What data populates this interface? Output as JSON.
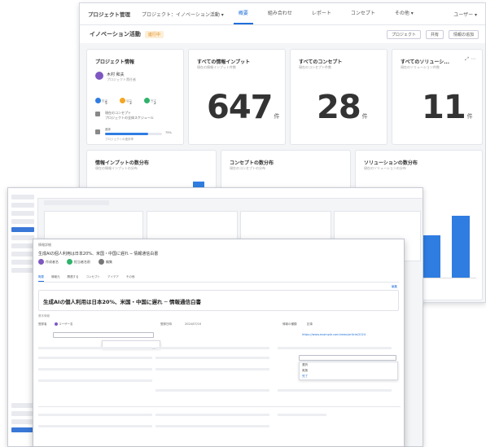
{
  "back_window": {
    "app_title": "プロジェクト管理",
    "breadcrumb": "プロジェクト：イノベーション活動 ▾",
    "nav": [
      "概要",
      "組み合わせ",
      "レポート",
      "コンセプト",
      "その他 ▾"
    ],
    "user_menu": "ユーザー ▾",
    "page_title": "イノベーション活動",
    "status_badge": "進行中",
    "toolbar_buttons": [
      "プロジェクト",
      "共有",
      "情報の追加"
    ],
    "project_info": {
      "title": "プロジェクト情報",
      "owner_name": "木村 和夫",
      "owner_role": "プロジェクト責任者",
      "member_counts": [
        "5",
        "3",
        "2"
      ],
      "member_labels": [
        "担当",
        "協力",
        "完了"
      ],
      "note_line1": "現在のコンセプト",
      "note_line2": "プロジェクトの全体スケジュール",
      "progress_label": "進捗",
      "progress_pct": "75%",
      "progress_value": 0.75,
      "progress_caption": "プロジェクトの進捗率"
    },
    "kpis": [
      {
        "title": "すべての情報インプット",
        "subtitle": "現在の情報インプット件数",
        "value": "647",
        "unit": "件"
      },
      {
        "title": "すべてのコンセプト",
        "subtitle": "現在のコンセプト件数",
        "value": "28",
        "unit": "件"
      },
      {
        "title": "すべてのソリューシ...",
        "subtitle": "現在のソリューション件数",
        "value": "11",
        "unit": "件"
      }
    ],
    "charts": [
      {
        "title": "情報インプットの数分布",
        "subtitle": "現在の情報インプットの分布"
      },
      {
        "title": "コンセプトの数分布",
        "subtitle": "現在のコンセプトの分布"
      },
      {
        "title": "ソリューションの数分布",
        "subtitle": "現在のソリューションの分布"
      }
    ]
  },
  "front_window": {
    "header": "情報詳細",
    "title": "生成AIの個人利用は日本20%、米国・中国に遅れ ─ 情報通信白書",
    "users": [
      "作成者名",
      "担当者名前",
      "編集"
    ],
    "tabs": [
      "概要",
      "情報元",
      "関連する",
      "コンセプト",
      "アイデア",
      "その他"
    ],
    "edit_label": "編集",
    "headline": "生成AIの個人利用は日本20%、米国・中国に遅れ ─ 情報通信白書",
    "section_label": "基本情報",
    "fields": [
      {
        "label": "登録者",
        "value": "ユーザー名"
      },
      {
        "label": "登録日時",
        "value": "2024/07/10"
      },
      {
        "label": "情報の種類",
        "value": "記事"
      }
    ],
    "dropdown_options": [
      "選択",
      "実施",
      "完了"
    ],
    "source_link": "https://www.example.com/news/article/2024"
  }
}
